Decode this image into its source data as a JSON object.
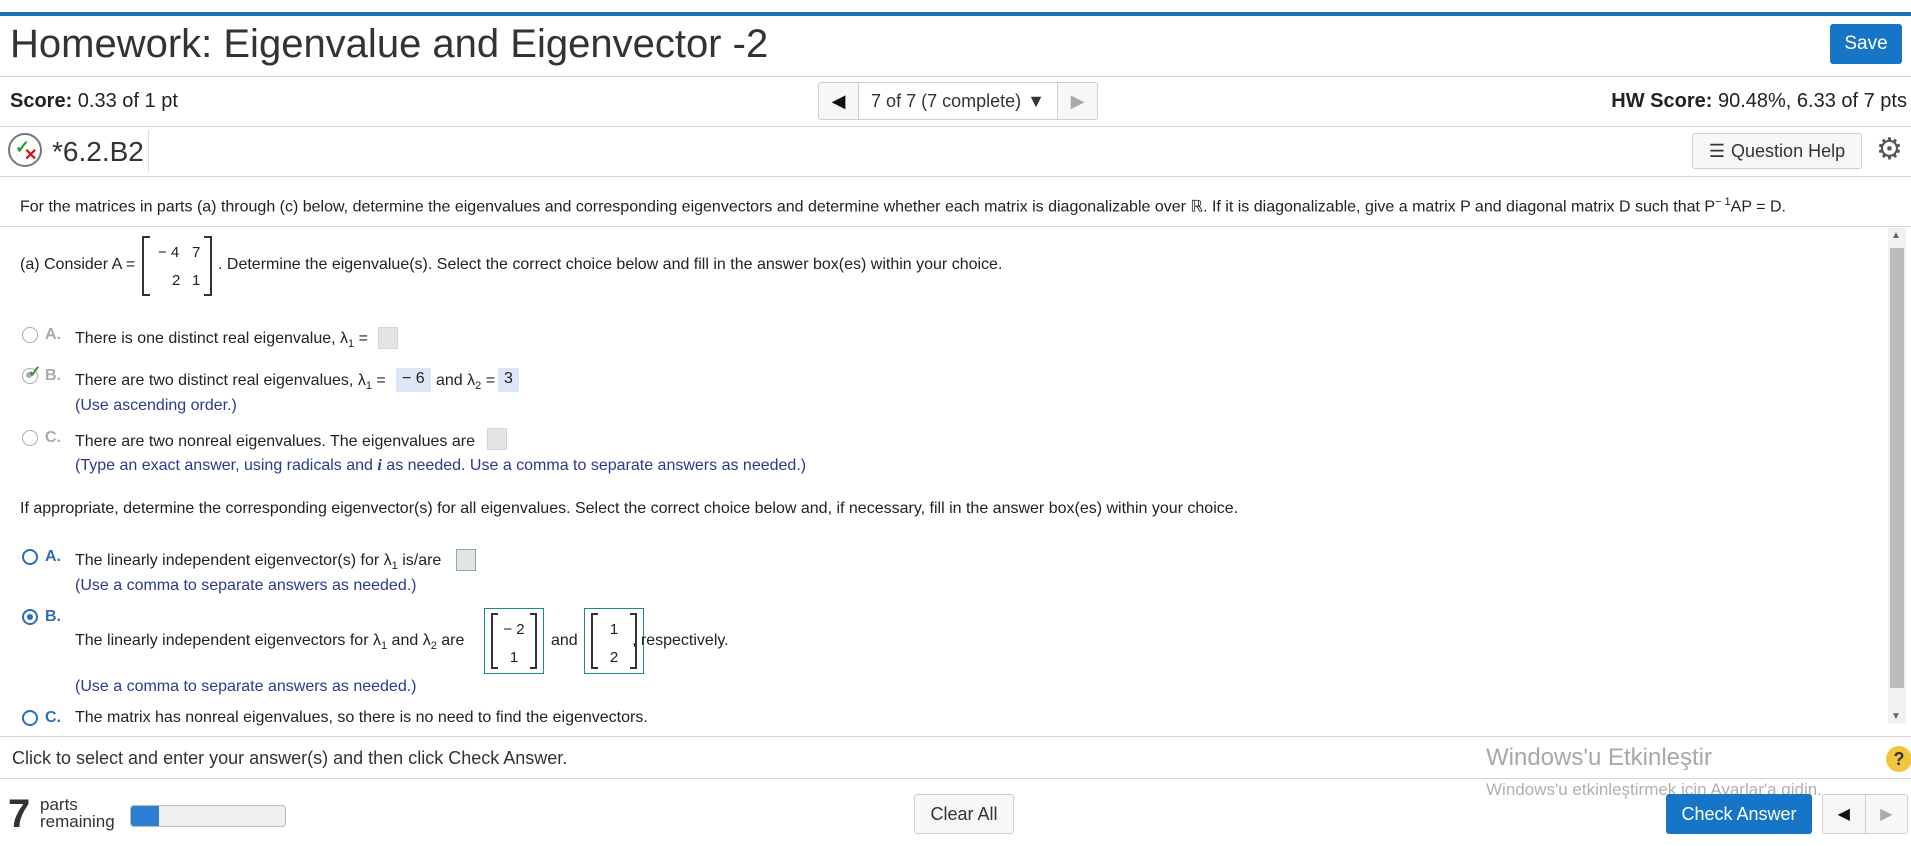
{
  "header": {
    "title": "Homework: Eigenvalue and Eigenvector -2",
    "save_label": "Save"
  },
  "scorebar": {
    "score_label": "Score:",
    "score_value": " 0.33 of 1 pt",
    "nav_position": "7 of 7 (7 complete)",
    "hw_score_label": "HW Score:",
    "hw_score_value": " 90.48%, 6.33 of 7 pts"
  },
  "question": {
    "id": "*6.2.B2",
    "help_label": "Question Help",
    "instructions_a": "For the matrices in parts (a) through (c) below, determine the eigenvalues and corresponding eigenvectors and determine whether each matrix is diagonalizable over ℝ. If it is diagonalizable, give a matrix P and diagonal matrix D such that P",
    "instructions_sup": "− 1",
    "instructions_b": "AP = D.",
    "part_a_prefix": "(a) Consider A =",
    "part_a_suffix": ". Determine the eigenvalue(s). Select the correct choice below and fill in the answer box(es) within your choice.",
    "matrix_a": [
      "− 4",
      "7",
      "2",
      "1"
    ],
    "eig_choices": {
      "a_letter": "A.",
      "a_text": "There is one distinct real eigenvalue, λ",
      "b_letter": "B.",
      "b_text1": "There are two distinct real eigenvalues, λ",
      "b_and": "and λ",
      "b_val1": "− 6",
      "b_val2": "3",
      "b_hint": "(Use ascending order.)",
      "c_letter": "C.",
      "c_text": "There are two nonreal eigenvalues. The eigenvalues are",
      "c_hint_1": "(Type an exact answer, using radicals and ",
      "c_hint_i": "i",
      "c_hint_2": " as needed. Use a comma to separate answers as needed.)"
    },
    "eigvec_prompt": "If appropriate, determine the corresponding eigenvector(s) for all eigenvalues. Select the correct choice below and, if necessary, fill in the answer box(es) within your choice.",
    "vec_choices": {
      "a_letter": "A.",
      "a_text1": "The linearly independent eigenvector(s) for λ",
      "a_text2": " is/are",
      "a_hint": "(Use a comma to separate answers as needed.)",
      "b_letter": "B.",
      "b_text1": "The linearly independent eigenvectors for λ",
      "b_and": "and λ",
      "b_are": "are",
      "b_mid": "and",
      "b_end": ", respectively.",
      "vec1": [
        "− 2",
        "1"
      ],
      "vec2": [
        "1",
        "2"
      ],
      "b_hint": "(Use a comma to separate answers as needed.)",
      "c_letter": "C.",
      "c_text": "The matrix has nonreal eigenvalues, so there is no need to find the eigenvectors."
    },
    "sub1": "1",
    "sub2": "2",
    "eq": "="
  },
  "footer": {
    "note": "Click to select and enter your answer(s) and then click Check Answer.",
    "windows_line1": "Windows'u Etkinleştir",
    "windows_line2": "Windows'u etkinleştirmek için Ayarlar'a gidin.",
    "help_q": "?",
    "parts_count": "7",
    "parts_label_1": "parts",
    "parts_label_2": "remaining",
    "progress_fraction": 0.18,
    "clear_label": "Clear All",
    "check_label": "Check Answer"
  },
  "colors": {
    "accent": "#1775c8",
    "hint": "#2b3990",
    "correct": "#2a9d2a",
    "incorrect": "#d01010"
  }
}
